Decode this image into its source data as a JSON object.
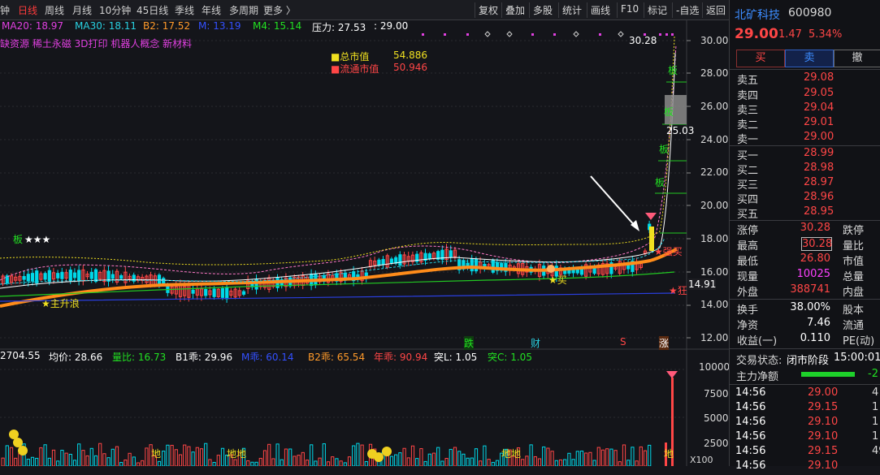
{
  "toolbar": {
    "periods": [
      "钟",
      "日线",
      "周线",
      "月线",
      "10分钟",
      "45日线",
      "季线",
      "年线",
      "多周期",
      "更多 〉"
    ],
    "active_period": "日线",
    "buttons": [
      "复权",
      "叠加",
      "多股",
      "统计",
      "画线",
      "F10",
      "标记",
      "-自选",
      "返回"
    ]
  },
  "main_indicators": {
    "ma20": "MA20: 18.97",
    "ma30": "MA30: 18.11",
    "b2": "B2: 17.52",
    "m": "M: 13.19",
    "m4": "M4: 15.14",
    "yali": "压力: 27.53",
    "extra": ": 29.00",
    "concepts": "缺资源 稀土永磁 3D打印 机器人概念 新材料",
    "market_cap_label": "总市值",
    "market_cap_value": "54.886",
    "float_cap_label": "流通市值",
    "float_cap_value": "50.946"
  },
  "price_axis": {
    "ticks": [
      "30.00",
      "28.00",
      "26.00",
      "24.00",
      "22.00",
      "20.00",
      "18.00",
      "16.00",
      "14.00",
      "12.00"
    ],
    "high_label": "30.28",
    "box_label": "25.03",
    "line_label": "14.91"
  },
  "chart_marks": {
    "ban": "板",
    "stars": "★★★",
    "zhu_sheng_lang": "★主升浪",
    "mai": "★买",
    "qiang_mai": "★强买",
    "kuang": "★狂",
    "die": "跌",
    "cai": "财",
    "s": "S",
    "zhang": "涨",
    "di": "地",
    "di_di": "地地"
  },
  "volume_indicators": {
    "v0": "2704.55",
    "avg": "均价: 28.66",
    "ratio": "量比: 16.73",
    "b1": "B1乖: 29.96",
    "m": "M乖: 60.14",
    "b2": "B2乖: 65.54",
    "year": "年乖: 90.94",
    "tu_l": "突L: 1.05",
    "tu_c": "突C: 1.05"
  },
  "volume_axis": {
    "ticks": [
      "10000",
      "7500",
      "5000",
      "2500"
    ],
    "unit": "X100"
  },
  "stock": {
    "name": "北矿科技",
    "code": "600980",
    "price": "29.00",
    "change": "1.47",
    "change_pct": "5.34%",
    "buy_label": "买",
    "sell_label": "卖",
    "cancel_label": "撤"
  },
  "order_book": {
    "asks": [
      {
        "label": "卖五",
        "price": "29.08"
      },
      {
        "label": "卖四",
        "price": "29.05"
      },
      {
        "label": "卖三",
        "price": "29.04"
      },
      {
        "label": "卖二",
        "price": "29.01"
      },
      {
        "label": "卖一",
        "price": "29.00"
      }
    ],
    "bids": [
      {
        "label": "买一",
        "price": "28.99"
      },
      {
        "label": "买二",
        "price": "28.98"
      },
      {
        "label": "买三",
        "price": "28.97"
      },
      {
        "label": "买四",
        "price": "28.96"
      },
      {
        "label": "买五",
        "price": "28.95"
      }
    ]
  },
  "quote": {
    "zhangting_label": "涨停",
    "zhangting": "30.28",
    "dieting_label": "跌停",
    "zuigao_label": "最高",
    "zuigao": "30.28",
    "liangbi_label": "量比",
    "zuidi_label": "最低",
    "zuidi": "26.80",
    "shizhi_label": "市值",
    "xianliang_label": "现量",
    "xianliang": "10025",
    "zongliang_label": "总量",
    "waipan_label": "外盘",
    "waipan": "388741",
    "neipan_label": "内盘",
    "huanshou_label": "换手",
    "huanshou": "38.00%",
    "guben_label": "股本",
    "jingzi_label": "净资",
    "jingzi": "7.46",
    "liutong_label": "流通",
    "shouyi_label": "收益(一)",
    "shouyi": "0.110",
    "pe_label": "PE(动)"
  },
  "status": {
    "label": "交易状态:",
    "value": "闭市阶段",
    "time": "15:00:01",
    "main_net_label": "主力净额",
    "main_net_value": "-2"
  },
  "ticks": [
    {
      "time": "14:56",
      "price": "29.00",
      "vol": "4"
    },
    {
      "time": "14:56",
      "price": "29.15",
      "vol": "1"
    },
    {
      "time": "14:56",
      "price": "29.10",
      "vol": "1"
    },
    {
      "time": "14:56",
      "price": "29.10",
      "vol": "1"
    },
    {
      "time": "14:56",
      "price": "29.15",
      "vol": "49"
    },
    {
      "time": "14:56",
      "price": "29.10",
      "vol": ""
    }
  ],
  "colors": {
    "up": "#ff4646",
    "down": "#00e0e0",
    "ma_orange": "#ff8c1a",
    "ma_green": "#22c922",
    "ma_blue": "#2233cc",
    "yellow": "#f0e020",
    "magenta": "#e040e0"
  }
}
